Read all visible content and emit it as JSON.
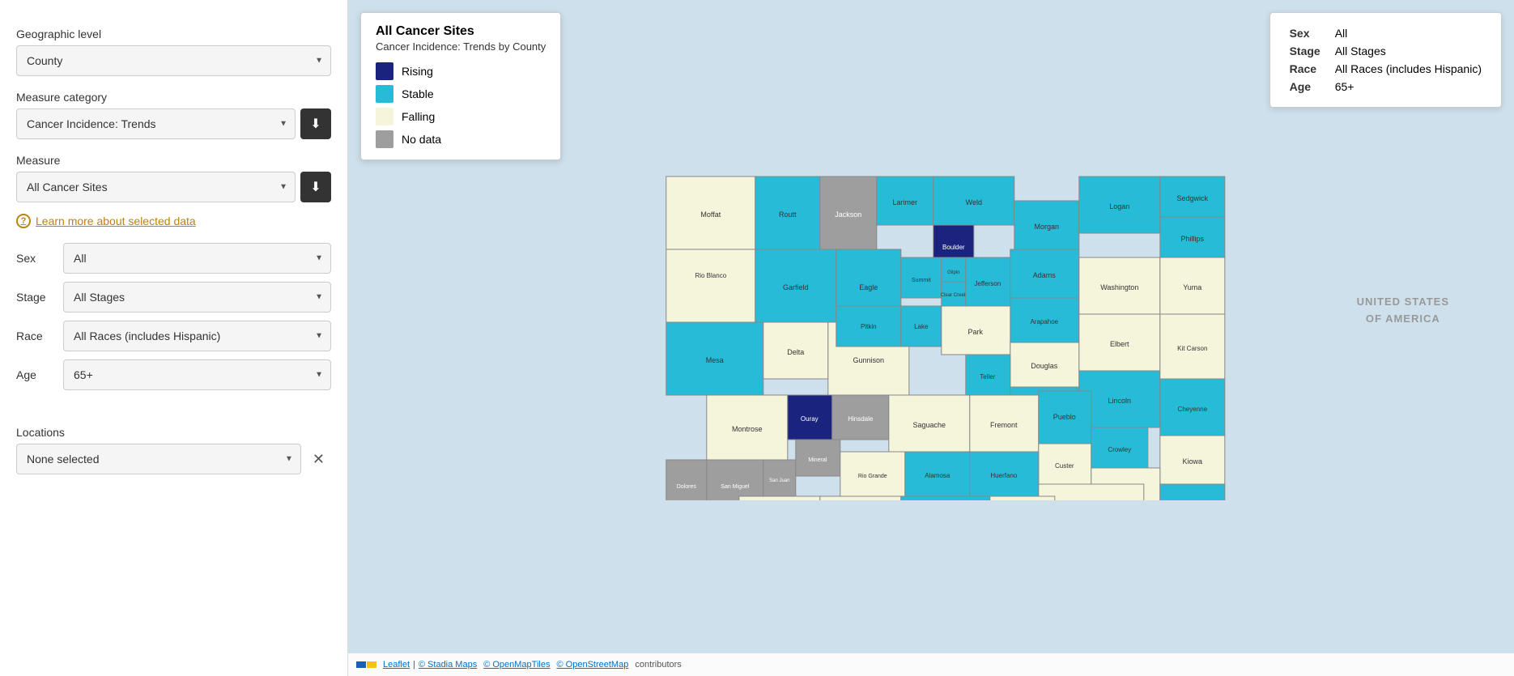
{
  "sidebar": {
    "geographic_level_label": "Geographic level",
    "geographic_level_value": "County",
    "measure_category_label": "Measure category",
    "measure_category_value": "Cancer Incidence: Trends",
    "measure_label": "Measure",
    "measure_value": "All Cancer Sites",
    "learn_more_text": "Learn more about selected data",
    "help_icon": "?",
    "filters": [
      {
        "label": "Sex",
        "value": "All"
      },
      {
        "label": "Stage",
        "value": "All Stages"
      },
      {
        "label": "Race",
        "value": "All Races (includes Hispanic)"
      },
      {
        "label": "Age",
        "value": "65+"
      }
    ],
    "locations_label": "Locations",
    "locations_value": "None selected",
    "download_icon": "⬇"
  },
  "legend": {
    "title": "All Cancer Sites",
    "subtitle": "Cancer Incidence: Trends by County",
    "items": [
      {
        "label": "Rising",
        "color": "#1a237e"
      },
      {
        "label": "Stable",
        "color": "#26bcd7"
      },
      {
        "label": "Falling",
        "color": "#f5f5dc"
      },
      {
        "label": "No data",
        "color": "#9e9e9e"
      }
    ]
  },
  "info_box": {
    "rows": [
      {
        "key": "Sex",
        "value": "All"
      },
      {
        "key": "Stage",
        "value": "All Stages"
      },
      {
        "key": "Race",
        "value": "All Races (includes Hispanic)"
      },
      {
        "key": "Age",
        "value": "65+"
      }
    ]
  },
  "attribution": {
    "leaflet_text": "Leaflet",
    "stadia_text": "© Stadia Maps",
    "openmaptiles_text": "© OpenMapTiles",
    "openstreetmap_text": "© OpenStreetMap",
    "contributors": "contributors"
  }
}
